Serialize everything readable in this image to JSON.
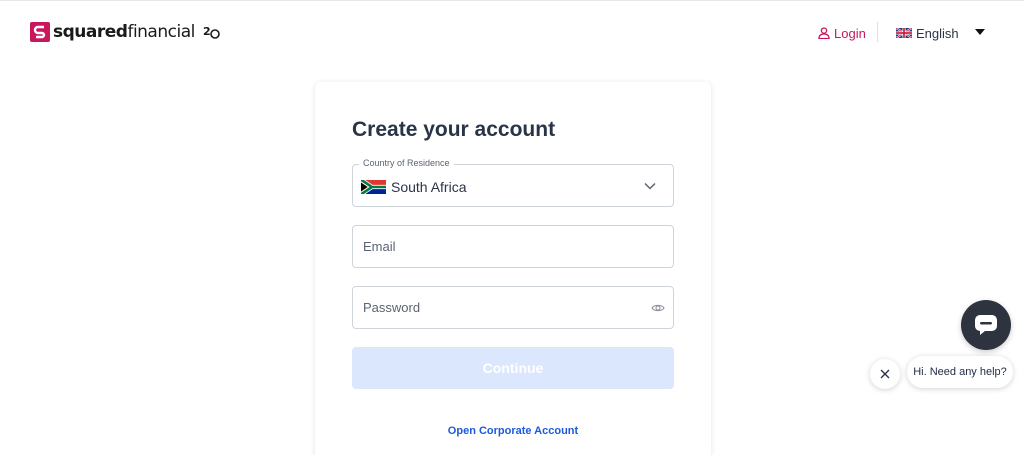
{
  "header": {
    "brand_bold": "squared",
    "brand_light": "financial",
    "anniversary": "20",
    "login_label": "Login",
    "language_label": "English"
  },
  "form": {
    "title": "Create your account",
    "country_label": "Country of Residence",
    "country_value": "South Africa",
    "email_placeholder": "Email",
    "password_placeholder": "Password",
    "continue_label": "Continue",
    "corporate_link": "Open Corporate Account"
  },
  "chat": {
    "greeting": "Hi. Need any help?"
  },
  "icons": {
    "login": "user-icon",
    "language": "uk-flag-icon",
    "country": "south-africa-flag-icon",
    "dropdown": "chevron-down-icon",
    "password": "eye-icon",
    "chat": "chat-icon",
    "close": "close-icon"
  },
  "colors": {
    "brand": "#c8175d",
    "link": "#1c5ad8",
    "button_disabled": "#dbe7fd",
    "chat_button": "#2d3440"
  }
}
